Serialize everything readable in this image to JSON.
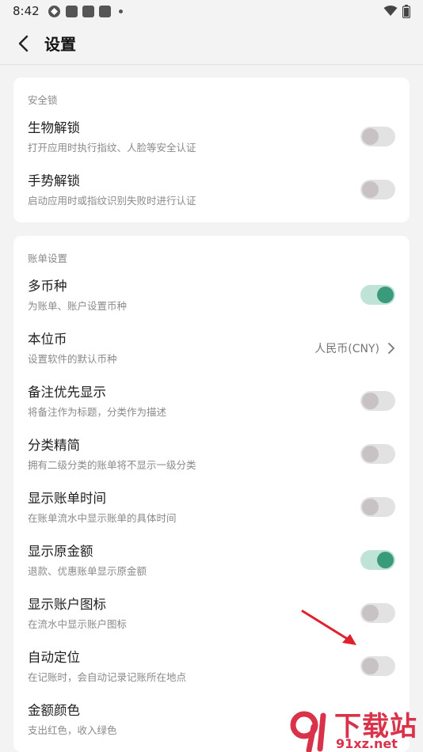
{
  "status": {
    "time": "8:42"
  },
  "header": {
    "title": "设置"
  },
  "sections": [
    {
      "title": "安全锁",
      "rows": [
        {
          "title": "生物解锁",
          "subtitle": "打开应用时执行指纹、人脸等安全认证",
          "type": "toggle",
          "on": false
        },
        {
          "title": "手势解锁",
          "subtitle": "启动应用时或指纹识别失败时进行认证",
          "type": "toggle",
          "on": false
        }
      ]
    },
    {
      "title": "账单设置",
      "rows": [
        {
          "title": "多币种",
          "subtitle": "为账单、账户设置币种",
          "type": "toggle",
          "on": true
        },
        {
          "title": "本位币",
          "subtitle": "设置软件的默认币种",
          "type": "value",
          "value": "人民币(CNY)"
        },
        {
          "title": "备注优先显示",
          "subtitle": "将备注作为标题，分类作为描述",
          "type": "toggle",
          "on": false
        },
        {
          "title": "分类精简",
          "subtitle": "拥有二级分类的账单将不显示一级分类",
          "type": "toggle",
          "on": false
        },
        {
          "title": "显示账单时间",
          "subtitle": "在账单流水中显示账单的具体时间",
          "type": "toggle",
          "on": false
        },
        {
          "title": "显示原金额",
          "subtitle": "退款、优惠账单显示原金额",
          "type": "toggle",
          "on": true
        },
        {
          "title": "显示账户图标",
          "subtitle": "在流水中显示账户图标",
          "type": "toggle",
          "on": false
        },
        {
          "title": "自动定位",
          "subtitle": "在记账时，会自动记录记账所在地点",
          "type": "toggle",
          "on": false
        },
        {
          "title": "金额颜色",
          "subtitle": "支出红色，收入绿色",
          "type": "none"
        }
      ]
    }
  ],
  "watermark": {
    "big": "下载站",
    "small": "91xz.net"
  },
  "colors": {
    "accent": "#3a9b7c",
    "watermark": "#d8334a",
    "arrow": "#e0202a"
  }
}
